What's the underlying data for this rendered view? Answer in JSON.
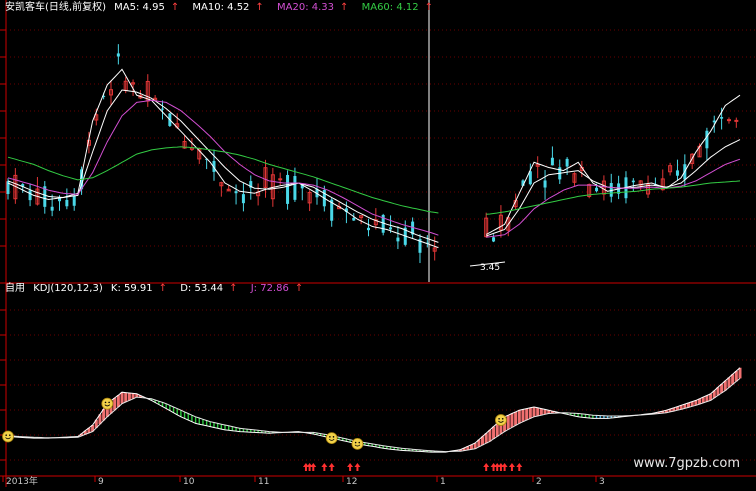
{
  "main_header": {
    "name": "安凯客车(日线,前复权)",
    "items": [
      {
        "label": "MA5: 4.95",
        "color": "#ffffff"
      },
      {
        "label": "MA10: 4.52",
        "color": "#ffffff"
      },
      {
        "label": "MA20: 4.33",
        "color": "#d24fd2"
      },
      {
        "label": "MA60: 4.12",
        "color": "#33cc44"
      }
    ],
    "up_arrow": "↑",
    "down_arrow": "↓"
  },
  "sub_header": {
    "name": "自用",
    "items": [
      {
        "label": "KDJ(120,12,3)",
        "color": "#ffffff"
      },
      {
        "label": "K: 59.91",
        "color": "#ffffff",
        "arrow": "↑"
      },
      {
        "label": "D: 53.44",
        "color": "#ffffff",
        "arrow": "↑"
      },
      {
        "label": "J: 72.86",
        "color": "#d24fd2",
        "arrow": "↑"
      }
    ]
  },
  "price_low_label": "3.45",
  "x_axis_labels": [
    "2013年",
    "9",
    "10",
    "11",
    "12",
    "1",
    "2",
    "3"
  ],
  "watermark": "www.7gpzb.com",
  "colors": {
    "axis": "#cc0000",
    "up_candle": "#e23636",
    "down_candle": "#4ad8e8",
    "ma5": "#ffffff",
    "ma10": "#ffffff",
    "ma20": "#d24fd2",
    "ma60": "#33cc44",
    "kdj_k": "#ffffff",
    "kdj_d": "#e8e8e8",
    "fill_bull": "#f07070",
    "fill_bear": "#2ecc40",
    "fill_cross": "#3ab8e8",
    "smiley": "#f2d24a",
    "signal_arrow": "#ff3030"
  },
  "chart_data": [
    {
      "type": "line",
      "title": "安凯客车(日线,前复权)",
      "xlabel": "",
      "ylabel": "",
      "x": [
        1,
        4,
        8,
        12,
        16,
        20,
        24,
        28,
        32,
        36,
        40,
        44,
        48,
        52,
        56,
        60,
        64,
        68,
        72,
        76,
        80,
        84,
        88,
        92,
        96,
        100,
        104,
        108,
        112,
        116,
        120,
        124,
        128,
        132,
        136,
        140,
        144,
        148,
        152,
        156,
        160,
        164,
        168,
        172,
        176,
        180,
        184,
        188,
        192,
        196,
        200
      ],
      "series": [
        {
          "name": "MA5: 4.95",
          "values": [
            4.1,
            4.05,
            3.98,
            3.94,
            3.96,
            4.0,
            4.7,
            5.05,
            5.2,
            4.95,
            4.9,
            4.75,
            4.6,
            4.45,
            4.3,
            4.1,
            4.02,
            4.0,
            4.05,
            4.08,
            4.1,
            4.02,
            3.93,
            3.85,
            3.75,
            3.68,
            3.65,
            3.6,
            3.55,
            3.5,
            3.45,
            3.5,
            3.55,
            3.62,
            3.7,
            4.0,
            4.3,
            4.25,
            4.22,
            4.3,
            4.1,
            4.02,
            4.05,
            4.08,
            4.1,
            4.05,
            4.15,
            4.4,
            4.6,
            4.85,
            4.95
          ]
        },
        {
          "name": "MA10: 4.52",
          "values": [
            4.12,
            4.08,
            4.02,
            3.97,
            3.96,
            3.98,
            4.4,
            4.8,
            5.0,
            4.98,
            4.92,
            4.82,
            4.7,
            4.55,
            4.4,
            4.25,
            4.12,
            4.05,
            4.04,
            4.06,
            4.1,
            4.06,
            3.98,
            3.9,
            3.82,
            3.75,
            3.7,
            3.66,
            3.6,
            3.55,
            3.5,
            3.52,
            3.55,
            3.6,
            3.65,
            3.85,
            4.1,
            4.18,
            4.2,
            4.22,
            4.12,
            4.06,
            4.05,
            4.06,
            4.08,
            4.06,
            4.1,
            4.22,
            4.35,
            4.45,
            4.52
          ]
        },
        {
          "name": "MA20: 4.33",
          "values": [
            4.15,
            4.12,
            4.08,
            4.03,
            4.0,
            3.99,
            4.2,
            4.5,
            4.75,
            4.88,
            4.9,
            4.88,
            4.8,
            4.68,
            4.55,
            4.4,
            4.28,
            4.18,
            4.12,
            4.1,
            4.1,
            4.08,
            4.03,
            3.96,
            3.88,
            3.8,
            3.75,
            3.7,
            3.66,
            3.62,
            3.57,
            3.56,
            3.56,
            3.58,
            3.6,
            3.7,
            3.85,
            3.95,
            4.03,
            4.08,
            4.08,
            4.06,
            4.05,
            4.05,
            4.06,
            4.05,
            4.07,
            4.12,
            4.2,
            4.28,
            4.33
          ]
        },
        {
          "name": "MA60: 4.12",
          "values": [
            4.35,
            4.32,
            4.28,
            4.22,
            4.17,
            4.13,
            4.15,
            4.22,
            4.3,
            4.38,
            4.42,
            4.44,
            4.45,
            4.44,
            4.42,
            4.4,
            4.37,
            4.33,
            4.28,
            4.24,
            4.2,
            4.16,
            4.11,
            4.06,
            4.01,
            3.96,
            3.92,
            3.88,
            3.85,
            3.82,
            3.8,
            3.79,
            3.79,
            3.8,
            3.82,
            3.85,
            3.88,
            3.91,
            3.94,
            3.97,
            3.99,
            4.0,
            4.01,
            4.02,
            4.04,
            4.05,
            4.06,
            4.08,
            4.1,
            4.11,
            4.12
          ]
        }
      ]
    },
    {
      "type": "line",
      "title": "KDJ(120,12,3)",
      "xlabel": "",
      "ylabel": "",
      "x": [
        1,
        4,
        8,
        12,
        16,
        20,
        24,
        28,
        32,
        36,
        40,
        44,
        48,
        52,
        56,
        60,
        64,
        68,
        72,
        76,
        80,
        84,
        88,
        92,
        96,
        100,
        104,
        108,
        112,
        116,
        120,
        124,
        128,
        132,
        136,
        140,
        144,
        148,
        152,
        156,
        160,
        164,
        168,
        172,
        176,
        180,
        184,
        188,
        192,
        196,
        200
      ],
      "series": [
        {
          "name": "K: 59.91",
          "values": [
            18,
            17.5,
            17,
            17,
            17.5,
            18,
            25,
            38,
            45,
            44,
            40,
            35,
            30,
            26,
            24,
            22,
            21,
            20.5,
            20,
            20.5,
            21,
            19.5,
            17.5,
            15.5,
            13.5,
            12,
            10.5,
            9.5,
            9,
            8.5,
            8.5,
            10,
            14,
            22,
            30,
            34,
            36,
            34,
            32,
            30,
            29,
            29,
            30,
            31,
            32,
            34,
            37,
            40,
            44,
            52,
            59.91
          ]
        },
        {
          "name": "D: 53.44",
          "values": [
            18.5,
            18,
            17.5,
            17.2,
            17.2,
            17.5,
            21,
            30,
            38,
            42,
            41,
            38,
            34,
            30,
            27,
            25,
            23,
            22,
            21,
            20.5,
            20.5,
            20.5,
            19,
            17,
            15,
            13.5,
            12,
            10.8,
            10,
            9.3,
            8.8,
            9,
            10.5,
            15,
            21,
            26,
            30,
            32,
            32.5,
            32,
            31,
            30.5,
            30.5,
            31,
            31.5,
            32.5,
            34.5,
            37,
            40,
            46,
            53.44
          ]
        },
        {
          "name": "J: 72.86",
          "values": [
            17,
            16.5,
            16,
            16.6,
            18.1,
            19,
            33,
            54,
            59,
            48,
            38,
            29,
            22,
            18,
            18,
            16,
            17,
            17.5,
            18,
            20.5,
            22,
            17.5,
            14.5,
            12.5,
            10.5,
            9,
            7.5,
            6.9,
            7,
            6.9,
            7.9,
            12,
            21,
            36,
            48,
            50,
            48,
            38,
            31,
            26,
            25,
            26,
            29,
            31,
            33,
            37,
            42,
            46,
            52,
            64,
            72.86
          ]
        }
      ]
    }
  ]
}
